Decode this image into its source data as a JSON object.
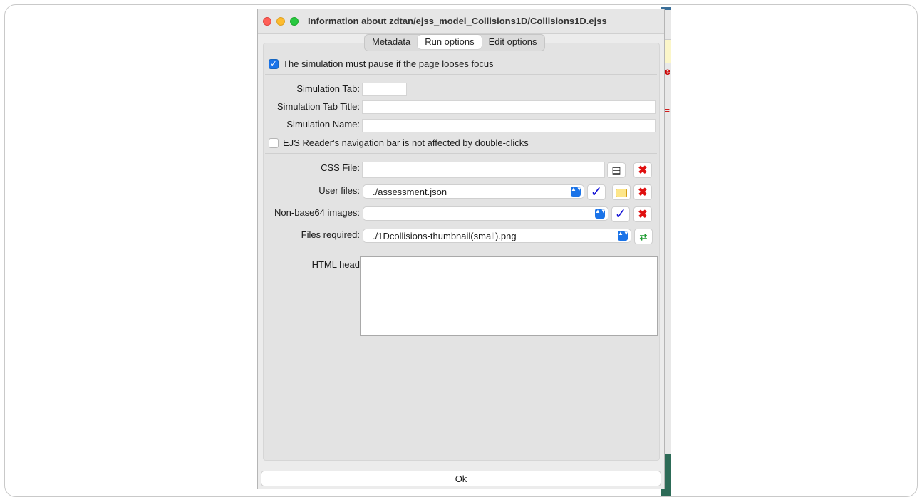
{
  "window": {
    "title": "Information about zdtan/ejss_model_Collisions1D/Collisions1D.ejss"
  },
  "tabs": [
    {
      "label": "Metadata",
      "active": false
    },
    {
      "label": "Run options",
      "active": true
    },
    {
      "label": "Edit options",
      "active": false
    }
  ],
  "options": {
    "pause_on_focus_loss": {
      "label": "The simulation must pause if the page looses focus",
      "checked": true
    },
    "nav_bar_double_click": {
      "label": "EJS Reader's navigation bar is not affected by double-clicks",
      "checked": false
    }
  },
  "fields": {
    "simulation_tab": {
      "label": "Simulation Tab:",
      "value": ""
    },
    "simulation_tab_title": {
      "label": "Simulation Tab Title:",
      "value": ""
    },
    "simulation_name": {
      "label": "Simulation Name:",
      "value": ""
    },
    "css_file": {
      "label": "CSS File:",
      "value": ""
    },
    "user_files": {
      "label": "User files:",
      "value": "./assessment.json"
    },
    "non_base64_images": {
      "label": "Non-base64 images:",
      "value": ""
    },
    "files_required": {
      "label": "Files required:",
      "value": "./1Dcollisions-thumbnail(small).png"
    },
    "html_head": {
      "label": "HTML head",
      "value": ""
    }
  },
  "icons": {
    "remove": "✖",
    "confirm": "✓",
    "refresh": "⇄",
    "combo_arrows": "▲▼"
  },
  "footer": {
    "ok_label": "Ok"
  },
  "colors": {
    "accent": "#1a73e8",
    "remove_red": "#e01010",
    "confirm_blue": "#1414d6",
    "refresh_green": "#1b9a2e"
  }
}
